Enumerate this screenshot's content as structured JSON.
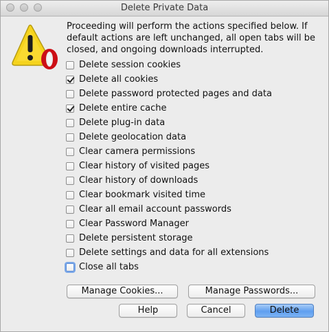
{
  "window": {
    "title": "Delete Private Data"
  },
  "message": "Proceeding will perform the actions specified below. If default actions are left unchanged, all open tabs will be closed, and ongoing downloads interrupted.",
  "options": [
    {
      "label": "Delete session cookies",
      "checked": false
    },
    {
      "label": "Delete all cookies",
      "checked": true
    },
    {
      "label": "Delete password protected pages and data",
      "checked": false
    },
    {
      "label": "Delete entire cache",
      "checked": true
    },
    {
      "label": "Delete plug-in data",
      "checked": false
    },
    {
      "label": "Delete geolocation data",
      "checked": false
    },
    {
      "label": "Clear camera permissions",
      "checked": false
    },
    {
      "label": "Clear history of visited pages",
      "checked": false
    },
    {
      "label": "Clear history of downloads",
      "checked": false
    },
    {
      "label": "Clear bookmark visited time",
      "checked": false
    },
    {
      "label": "Clear all email account passwords",
      "checked": false
    },
    {
      "label": "Clear Password Manager",
      "checked": false
    },
    {
      "label": "Delete persistent storage",
      "checked": false
    },
    {
      "label": "Delete settings and data for all extensions",
      "checked": false
    },
    {
      "label": "Close all tabs",
      "checked": false,
      "focused": true
    }
  ],
  "buttons": {
    "manage_cookies": "Manage Cookies...",
    "manage_passwords": "Manage Passwords...",
    "help": "Help",
    "cancel": "Cancel",
    "delete": "Delete"
  },
  "colors": {
    "warning_yellow": "#f5d31d",
    "opera_red": "#cc0f16",
    "primary_button": "#5f9ff0"
  },
  "icons": {
    "warning": "warning-icon",
    "opera": "opera-logo-icon"
  }
}
